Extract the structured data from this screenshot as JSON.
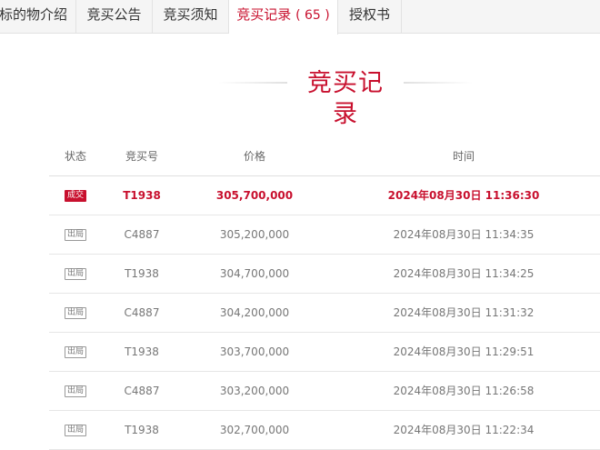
{
  "tabs": [
    {
      "label": "标的物介绍",
      "active": false
    },
    {
      "label": "竞买公告",
      "active": false
    },
    {
      "label": "竞买须知",
      "active": false
    },
    {
      "label": "竞买记录",
      "count": "( 65 )",
      "active": true
    },
    {
      "label": "授权书",
      "active": false
    }
  ],
  "section": {
    "title": "竞买记录"
  },
  "table": {
    "headers": {
      "status": "状态",
      "bid_no": "竞买号",
      "price": "价格",
      "time": "时间"
    },
    "rows": [
      {
        "status": "成交",
        "bid_no": "T1938",
        "price": "305,700,000",
        "time": "2024年08月30日 11:36:30",
        "winner": true
      },
      {
        "status": "出局",
        "bid_no": "C4887",
        "price": "305,200,000",
        "time": "2024年08月30日 11:34:35"
      },
      {
        "status": "出局",
        "bid_no": "T1938",
        "price": "304,700,000",
        "time": "2024年08月30日 11:34:25"
      },
      {
        "status": "出局",
        "bid_no": "C4887",
        "price": "304,200,000",
        "time": "2024年08月30日 11:31:32"
      },
      {
        "status": "出局",
        "bid_no": "T1938",
        "price": "303,700,000",
        "time": "2024年08月30日 11:29:51"
      },
      {
        "status": "出局",
        "bid_no": "C4887",
        "price": "303,200,000",
        "time": "2024年08月30日 11:26:58"
      },
      {
        "status": "出局",
        "bid_no": "T1938",
        "price": "302,700,000",
        "time": "2024年08月30日 11:22:34"
      }
    ]
  },
  "colors": {
    "accent": "#c8102e",
    "tab_bg": "#f5f5f5",
    "border": "#e2e2e2"
  }
}
